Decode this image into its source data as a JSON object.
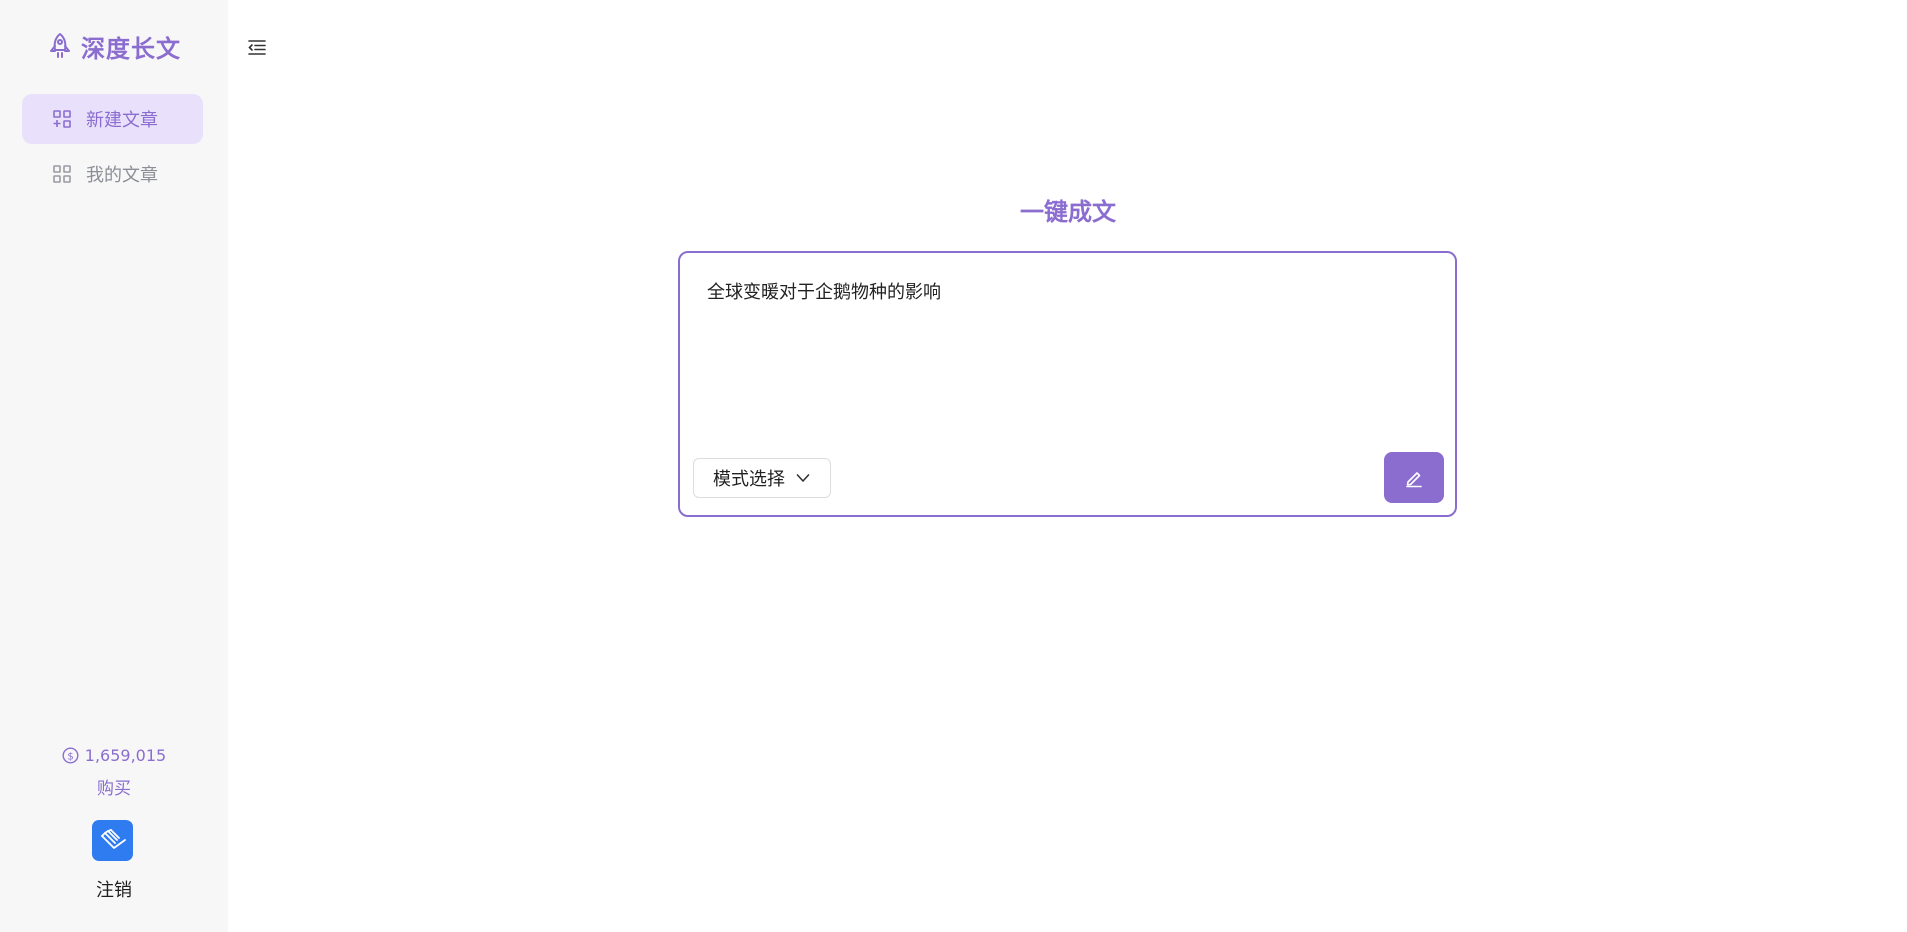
{
  "brand": {
    "title": "深度长文",
    "icon": "rocket-icon"
  },
  "sidebar": {
    "items": [
      {
        "label": "新建文章",
        "icon": "grid-plus-icon",
        "active": true
      },
      {
        "label": "我的文章",
        "icon": "grid-icon",
        "active": false
      }
    ],
    "credits": "1,659,015",
    "buy_label": "购买",
    "avatar_icon": "book-icon",
    "logout_label": "注销"
  },
  "header": {
    "collapse_icon": "collapse-menu-icon"
  },
  "main": {
    "title": "一键成文",
    "prompt_text": "全球变暖对于企鹅物种的影响",
    "mode_select_label": "模式选择",
    "submit_icon": "pen-icon"
  },
  "colors": {
    "accent": "#8b6dd0",
    "accent_light": "#e9e1fb",
    "sidebar_bg": "#f7f7f8",
    "avatar_bg": "#2f7bf0"
  }
}
